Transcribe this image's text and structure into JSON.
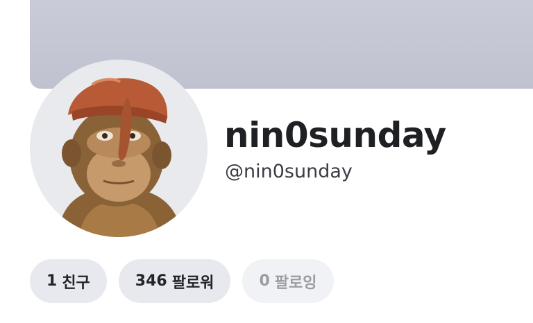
{
  "profile": {
    "display_name": "nin0sunday",
    "username": "@nin0sunday",
    "avatar_icon": "monkey-with-cap-avatar",
    "banner_color": "#c4c7d3"
  },
  "stats": {
    "friends": {
      "count": "1",
      "label": "친구"
    },
    "followers": {
      "count": "346",
      "label": "팔로워"
    },
    "following": {
      "count": "0",
      "label": "팔로잉"
    }
  }
}
